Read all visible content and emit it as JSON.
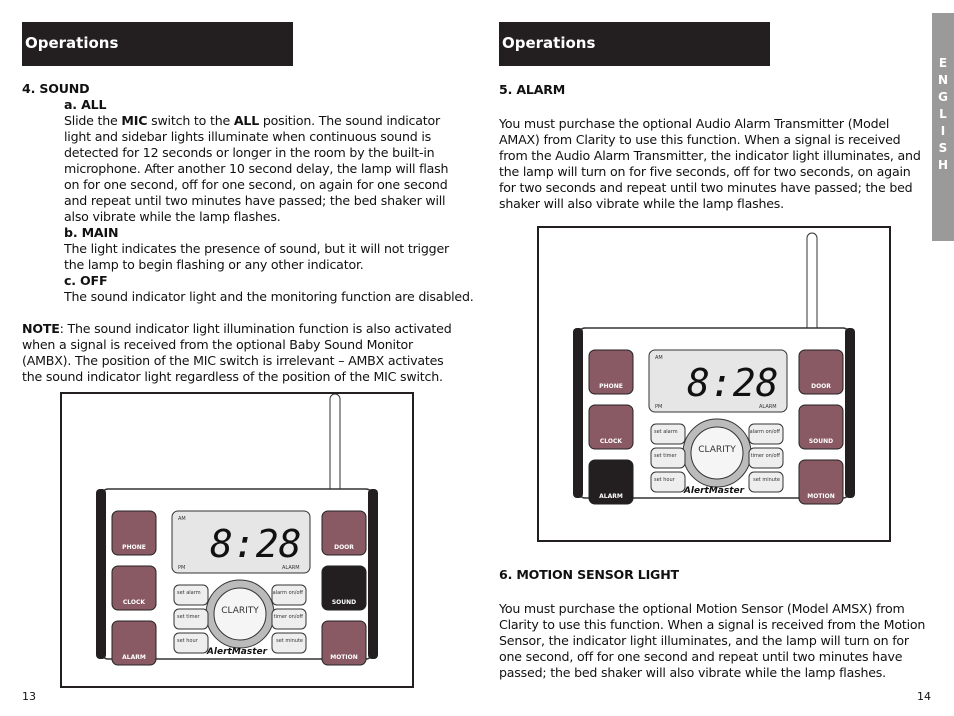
{
  "left": {
    "banner": "Operations",
    "section": "4. SOUND",
    "a_title": "a. ALL",
    "a_pre": "Slide the ",
    "a_b1": "MIC",
    "a_mid": " switch to the ",
    "a_b2": "ALL",
    "a_rest": " position. The sound indicator light and sidebar lights illuminate when continuous sound is detected for 12 seconds or longer in the room by the built-in microphone. After another 10 second delay, the lamp will flash on for one second, off for one second, on again for one second and repeat until two minutes have passed; the bed shaker will also vibrate while the lamp flashes.",
    "b_title": "b. MAIN",
    "b_text": "The light indicates the presence of sound, but it will not trigger the lamp to begin flashing or any other indicator.",
    "c_title": "c. OFF",
    "c_text": "The sound indicator light and the monitoring function are disabled.",
    "note_label": "NOTE",
    "note_text": ": The sound indicator light illumination function is also activated when a signal is received from the optional Baby Sound Monitor (AMBX). The position of the MIC switch is irrelevant – AMBX activates the sound indicator light regardless of the position of the MIC switch.",
    "page_number": "13"
  },
  "right": {
    "banner": "Operations",
    "alarm_title": "5. ALARM",
    "alarm_text": "You must purchase the optional Audio Alarm Transmitter (Model AMAX) from Clarity to use this function. When a signal is received from the Audio Alarm Transmitter, the indicator light illuminates, and the lamp will turn on for five seconds, off for two seconds, on again for two seconds and repeat until two minutes have passed; the bed shaker will also vibrate while the lamp flashes.",
    "motion_title": "6. MOTION SENSOR LIGHT",
    "motion_text": "You must purchase the optional Motion Sensor (Model AMSX) from Clarity to use this function. When a signal is received from the Motion Sensor, the indicator light illuminates, and the lamp will turn on for one second, off for one second and repeat until two minutes have passed; the bed shaker will also vibrate while the lamp flashes.",
    "page_number": "14",
    "side_tab": "E N G L I S H"
  },
  "device": {
    "time": "8:28",
    "am": "AM",
    "pm": "PM",
    "alarm_ind": "ALARM",
    "brand": "CLARITY",
    "model": "AlertMaster",
    "buttons": [
      "PHONE",
      "CLOCK",
      "ALARM",
      "DOOR",
      "SOUND",
      "MOTION"
    ],
    "keys": [
      "set alarm",
      "set timer",
      "set hour",
      "alarm on/off",
      "timer on/off",
      "set minute"
    ]
  },
  "colors": {
    "button": "#8a5a64",
    "active": "#231f20",
    "tab": "#9a9a9a"
  }
}
